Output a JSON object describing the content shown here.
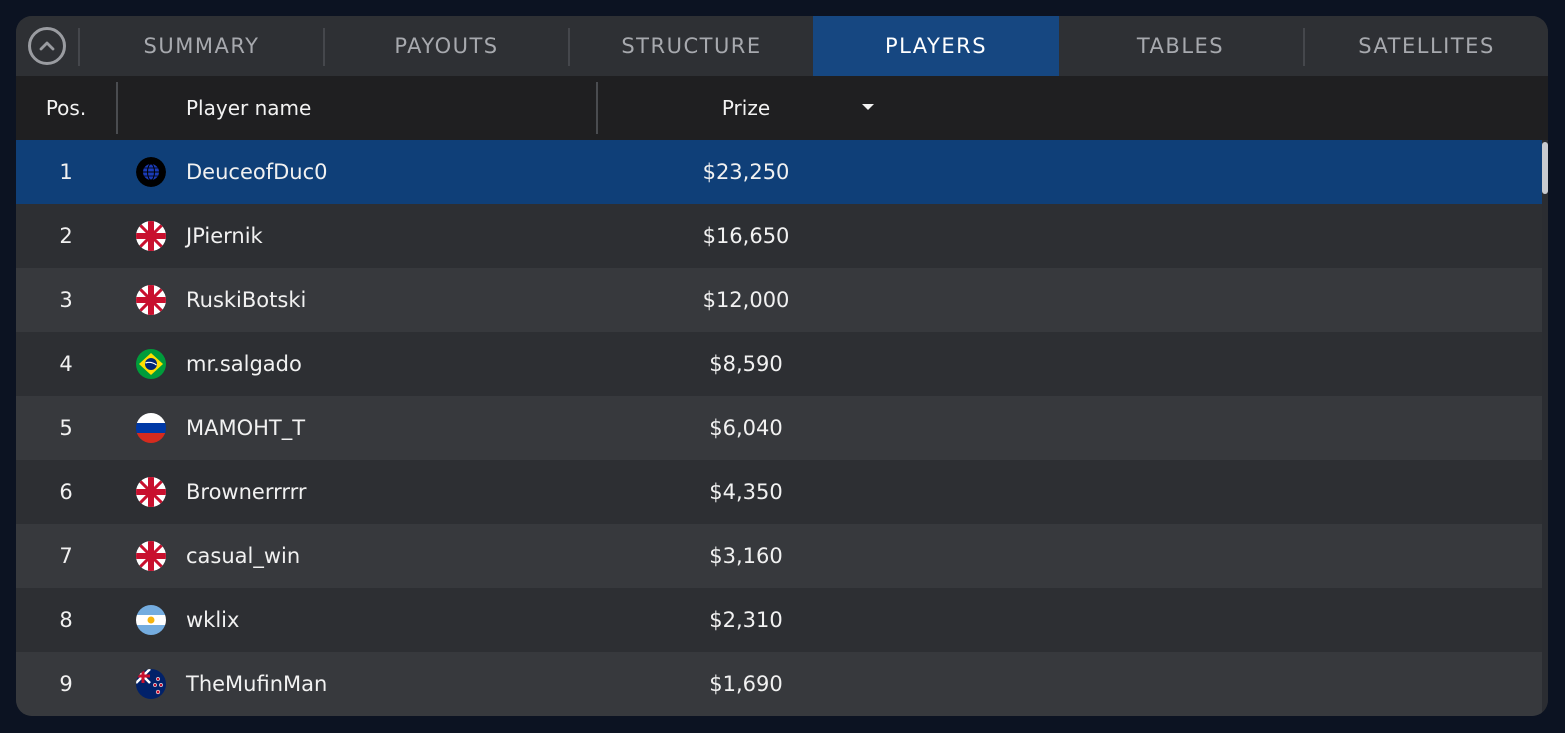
{
  "tabs": {
    "summary": "SUMMARY",
    "payouts": "PAYOUTS",
    "structure": "STRUCTURE",
    "players": "PLAYERS",
    "tables": "TABLES",
    "satellites": "SATELLITES",
    "active": "players"
  },
  "columns": {
    "pos": "Pos.",
    "player_name": "Player name",
    "prize": "Prize"
  },
  "players": [
    {
      "pos": "1",
      "name": "DeuceofDuc0",
      "prize": "$23,250",
      "flag": "globe-icon",
      "selected": true
    },
    {
      "pos": "2",
      "name": "JPiernik",
      "prize": "$16,650",
      "flag": "uk-flag-icon"
    },
    {
      "pos": "3",
      "name": "RuskiBotski",
      "prize": "$12,000",
      "flag": "uk-flag-icon"
    },
    {
      "pos": "4",
      "name": "mr.salgado",
      "prize": "$8,590",
      "flag": "brazil-flag-icon"
    },
    {
      "pos": "5",
      "name": "MAMOHT_T",
      "prize": "$6,040",
      "flag": "russia-flag-icon"
    },
    {
      "pos": "6",
      "name": "Brownerrrrr",
      "prize": "$4,350",
      "flag": "uk-flag-icon"
    },
    {
      "pos": "7",
      "name": "casual_win",
      "prize": "$3,160",
      "flag": "uk-flag-icon"
    },
    {
      "pos": "8",
      "name": "wklix",
      "prize": "$2,310",
      "flag": "argentina-flag-icon"
    },
    {
      "pos": "9",
      "name": "TheMufinMan",
      "prize": "$1,690",
      "flag": "new-zealand-flag-icon"
    }
  ],
  "colors": {
    "accent": "#164781",
    "selected_row": "#0f3f78",
    "background": "#0c1322"
  }
}
